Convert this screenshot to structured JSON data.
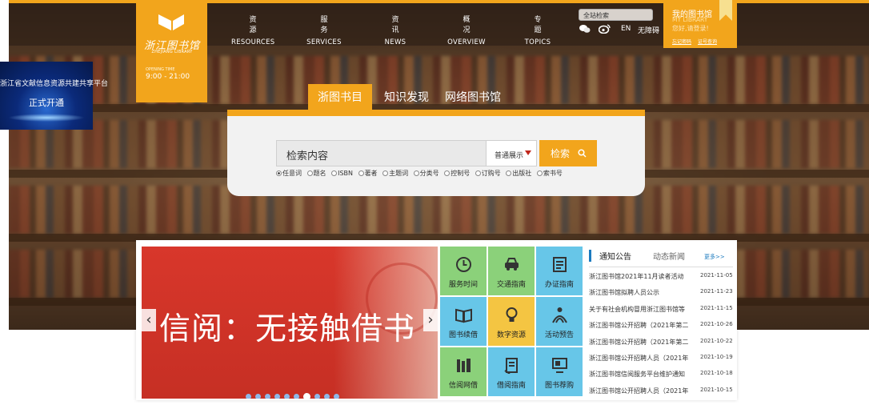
{
  "brand": {
    "logo_text": "浙江图书馆",
    "logo_en": "ZHEJIANG LIBRARY",
    "opening_label": "OPENING TIME",
    "hours": "9:00 - 21:00",
    "accent": "#f2a51c"
  },
  "nav": [
    {
      "cn": "资　源",
      "en": "RESOURCES"
    },
    {
      "cn": "服　务",
      "en": "SERVICES"
    },
    {
      "cn": "资　讯",
      "en": "NEWS"
    },
    {
      "cn": "概　况",
      "en": "OVERVIEW"
    },
    {
      "cn": "专　题",
      "en": "TOPICS"
    }
  ],
  "top_search": {
    "placeholder": "全站检索"
  },
  "tools": {
    "lang": "EN",
    "accessible": "无障碍"
  },
  "mylibrary": {
    "title": "我的图书馆",
    "en": "MY LIBRARY",
    "welcome": "您好,请登录!",
    "link1": "忘记密码",
    "link2": "证号查询"
  },
  "side_banner": {
    "line1": "浙江省文献信息资源共建共享平台",
    "line2": "正式开通"
  },
  "search": {
    "tabs": [
      "浙图书目",
      "知识发现",
      "网络图书馆"
    ],
    "input_value": "检索内容",
    "select_value": "普通展示",
    "button": "检索",
    "options": [
      "任意词",
      "题名",
      "ISBN",
      "著者",
      "主题词",
      "分类号",
      "控制号",
      "订购号",
      "出版社",
      "索书号"
    ]
  },
  "slider": {
    "title": "信阅：无接触借书",
    "prev": "‹",
    "next": "›",
    "dots": 10,
    "active_dot": 6
  },
  "tiles": [
    {
      "label": "服务时间",
      "bg": "#8bd17a",
      "icon": "clock-icon"
    },
    {
      "label": "交通指南",
      "bg": "#8bd17a",
      "icon": "car-icon"
    },
    {
      "label": "办证指南",
      "bg": "#67c6e8",
      "icon": "card-icon"
    },
    {
      "label": "图书续借",
      "bg": "#67c6e8",
      "icon": "book-icon"
    },
    {
      "label": "数字资源",
      "bg": "#f4c542",
      "icon": "bulb-icon"
    },
    {
      "label": "活动预告",
      "bg": "#67c6e8",
      "icon": "people-icon"
    },
    {
      "label": "信阅网借",
      "bg": "#8bd17a",
      "icon": "books-icon"
    },
    {
      "label": "借阅指南",
      "bg": "#67c6e8",
      "icon": "guide-icon"
    },
    {
      "label": "图书荐购",
      "bg": "#67c6e8",
      "icon": "monitor-icon"
    }
  ],
  "news": {
    "tab_active": "通知公告",
    "tab_other": "动态新闻",
    "more": "更多>>",
    "items": [
      {
        "title": "浙江图书馆2021年11月读者活动",
        "date": "2021-11-05"
      },
      {
        "title": "浙江图书馆拟聘人员公示",
        "date": "2021-11-23"
      },
      {
        "title": "关于有社会机构冒用浙江图书馆等",
        "date": "2021-11-15"
      },
      {
        "title": "浙江图书馆公开招聘（2021年第二",
        "date": "2021-10-26"
      },
      {
        "title": "浙江图书馆公开招聘（2021年第二",
        "date": "2021-10-22"
      },
      {
        "title": "浙江图书馆公开招聘人员（2021年",
        "date": "2021-10-19"
      },
      {
        "title": "浙江图书馆信阅服务平台维护通知",
        "date": "2021-10-18"
      },
      {
        "title": "浙江图书馆公开招聘人员（2021年",
        "date": "2021-10-15"
      }
    ]
  }
}
